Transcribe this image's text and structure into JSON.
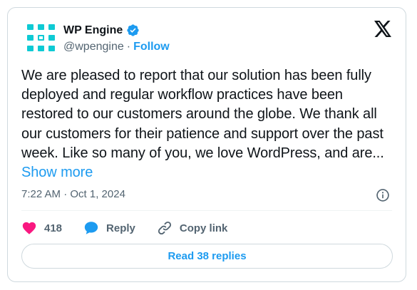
{
  "account": {
    "name": "WP Engine",
    "handle": "@wpengine",
    "separator": "·",
    "follow_label": "Follow",
    "avatar_icon": "wp-engine-logo-icon",
    "verified_icon": "verified-badge-icon",
    "colors": {
      "avatar": "#0ecad4",
      "verified": "#1d9bf0",
      "link": "#1d9bf0"
    }
  },
  "platform_icon": "x-logo-icon",
  "tweet": {
    "text": "We are pleased to report that our solution has been fully deployed and regular workflow practices have been restored to our customers around the globe. We thank all our customers for their patience and support over the past week. Like so many of you, we love WordPress, and are...",
    "show_more_label": "Show more",
    "timestamp": "7:22 AM · Oct 1, 2024"
  },
  "actions": {
    "like_count": "418",
    "reply_label": "Reply",
    "copy_link_label": "Copy link",
    "like_icon": "heart-icon",
    "reply_icon": "speech-bubble-icon",
    "copy_link_icon": "link-icon",
    "info_icon": "info-icon",
    "colors": {
      "like": "#f91880",
      "reply": "#1d9bf0"
    }
  },
  "read_replies_label": "Read 38 replies"
}
